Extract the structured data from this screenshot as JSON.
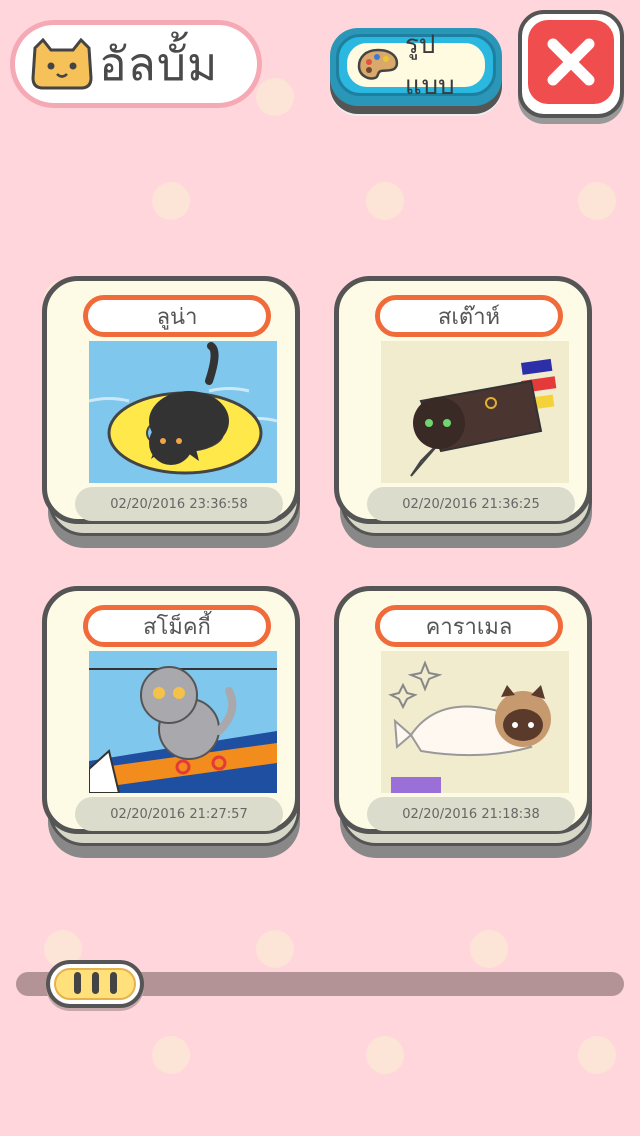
{
  "header": {
    "title": "อัลบั้ม",
    "style_button_label": "รูปแบบ"
  },
  "cards": [
    {
      "name": "ลูน่า",
      "date": "02/20/2016 23:36:58"
    },
    {
      "name": "สเต๊าห์",
      "date": "02/20/2016 21:36:25"
    },
    {
      "name": "สโม็คกี้",
      "date": "02/20/2016 21:27:57"
    },
    {
      "name": "คาราเมล",
      "date": "02/20/2016 21:18:38"
    }
  ],
  "colors": {
    "background": "#ffd6db",
    "close": "#f04e4e",
    "style_button": "#2ab7e0",
    "name_tag_border": "#f06a3a"
  }
}
